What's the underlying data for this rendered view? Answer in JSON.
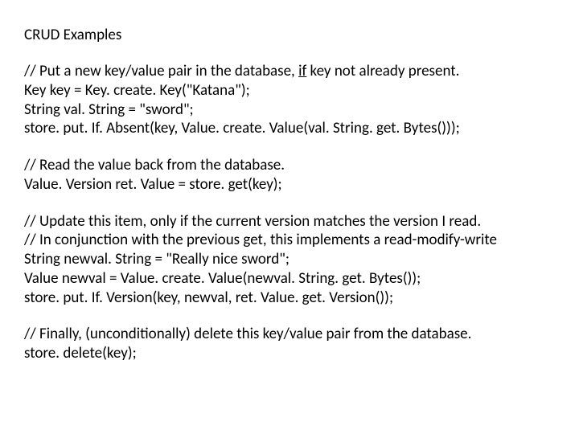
{
  "title": "CRUD Examples",
  "block1": {
    "c1a": "// Put a new key/value pair in the database, ",
    "c1b": "if",
    "c1c": " key not already present.",
    "l2": "Key key = Key. create. Key(\"Katana\");",
    "l3": "String val. String = \"sword\";",
    "l4": "store. put. If. Absent(key, Value. create. Value(val. String. get. Bytes()));"
  },
  "block2": {
    "c1": "// Read the value back from the database.",
    "l2": "Value. Version ret. Value = store. get(key);"
  },
  "block3": {
    "c1": "// Update this item, only if the current version matches the version I read.",
    "c2": "// In conjunction with the previous get, this implements a read-modify-write",
    "l3": "String newval. String = \"Really nice sword\";",
    "l4": "Value newval = Value. create. Value(newval. String. get. Bytes());",
    "l5": "store. put. If. Version(key, newval, ret. Value. get. Version());"
  },
  "block4": {
    "c1": "// Finally, (unconditionally) delete this key/value pair from the database.",
    "l2": "store. delete(key);"
  }
}
